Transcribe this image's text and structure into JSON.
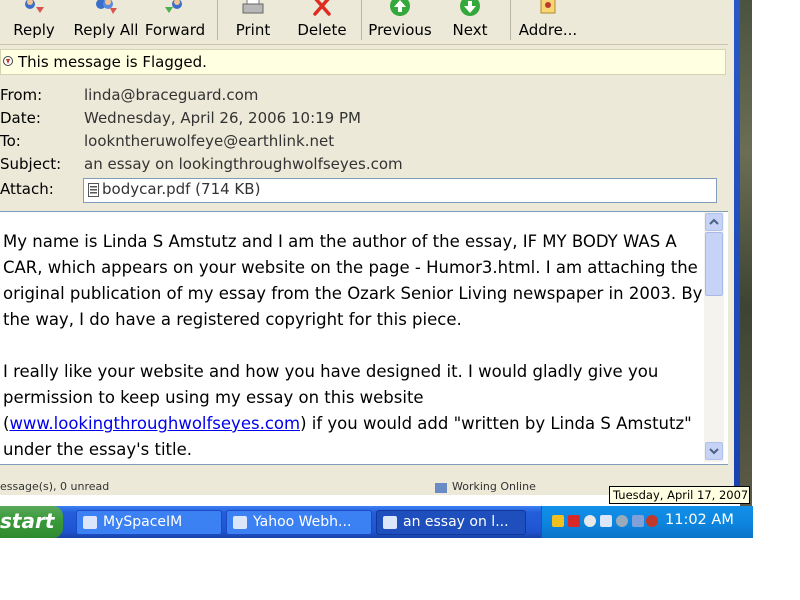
{
  "toolbar": {
    "buttons": [
      {
        "label": "Reply"
      },
      {
        "label": "Reply All"
      },
      {
        "label": "Forward"
      },
      {
        "label": "Print"
      },
      {
        "label": "Delete"
      },
      {
        "label": "Previous"
      },
      {
        "label": "Next"
      },
      {
        "label": "Addre..."
      }
    ]
  },
  "flag_bar": {
    "text": "This message is Flagged."
  },
  "headers": {
    "from_label": "From:",
    "from": "linda@braceguard.com",
    "date_label": "Date:",
    "date": "Wednesday, April 26, 2006 10:19 PM",
    "to_label": "To:",
    "to": "lookntheruwolfeye@earthlink.net",
    "subject_label": "Subject:",
    "subject": "an essay on lookingthroughwolfseyes.com",
    "attach_label": "Attach:",
    "attachment": "bodycar.pdf (714 KB)"
  },
  "body": {
    "p1": "My name is Linda S Amstutz and I am the author of the essay, IF MY BODY WAS A CAR, which appears on your website on the page - Humor3.html. I am attaching the original publication of my essay from the Ozark Senior Living newspaper in 2003. By the way, I do have a registered copyright for this piece.",
    "p2_before": "I really like your website and how you have designed it. I would gladly give you permission to keep using my essay on this website (",
    "p2_link": "www.lookingthroughwolfseyes.com",
    "p2_after": ") if you would add \"written by Linda S Amstutz\" under the essay's title."
  },
  "status_bar": {
    "left": "essage(s), 0 unread",
    "right": "Working Online"
  },
  "taskbar": {
    "start_label": "start",
    "tasks": [
      {
        "label": "MySpaceIM"
      },
      {
        "label": "Yahoo Webh..."
      },
      {
        "label": "an essay on l..."
      }
    ],
    "clock": "11:02 AM"
  },
  "tooltip": {
    "text": "Tuesday, April 17, 2007"
  },
  "colors": {
    "taskbar": "#245edb",
    "start": "#3c9b3c",
    "tray": "#0d86e0",
    "link": "#0000ee"
  }
}
